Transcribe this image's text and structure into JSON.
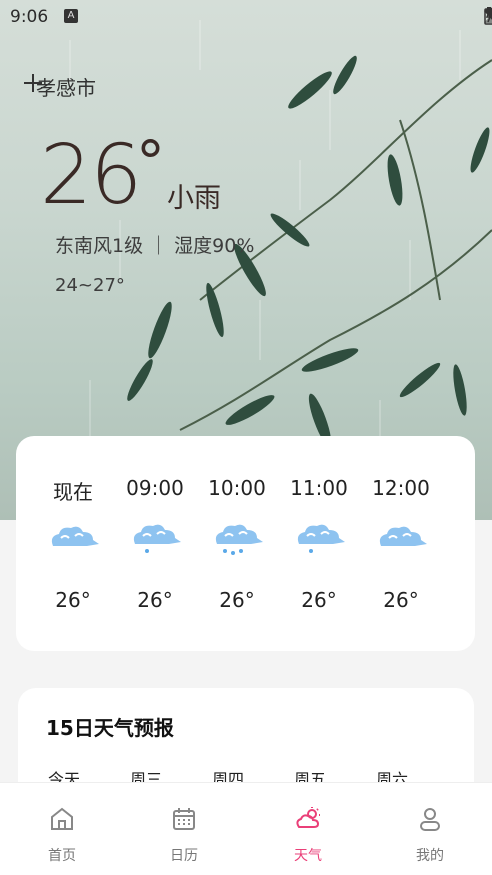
{
  "status_bar": {
    "time": "9:06",
    "a_badge": "A"
  },
  "header": {
    "add_icon": "plus-icon",
    "city": "孝感市"
  },
  "current": {
    "temperature": "26",
    "degree": "°",
    "condition": "小雨",
    "wind_humidity": "东南风1级 ｜ 湿度90%",
    "range": "24~27°"
  },
  "hourly": [
    {
      "label": "现在",
      "temp": "26°",
      "icon": "cloud-icon"
    },
    {
      "label": "09:00",
      "temp": "26°",
      "icon": "cloud-light-rain-icon"
    },
    {
      "label": "10:00",
      "temp": "26°",
      "icon": "cloud-rain-icon"
    },
    {
      "label": "11:00",
      "temp": "26°",
      "icon": "cloud-light-rain-icon"
    },
    {
      "label": "12:00",
      "temp": "26°",
      "icon": "cloud-icon"
    }
  ],
  "forecast": {
    "title": "15日天气预报",
    "days": [
      "今天",
      "周三",
      "周四",
      "周五",
      "周六"
    ]
  },
  "nav": [
    {
      "label": "首页",
      "icon": "home-icon"
    },
    {
      "label": "日历",
      "icon": "calendar-icon"
    },
    {
      "label": "天气",
      "icon": "weather-icon",
      "active": true
    },
    {
      "label": "我的",
      "icon": "profile-icon"
    }
  ],
  "colors": {
    "accent": "#ea3f78",
    "icon_blue": "#5ba9e8"
  }
}
